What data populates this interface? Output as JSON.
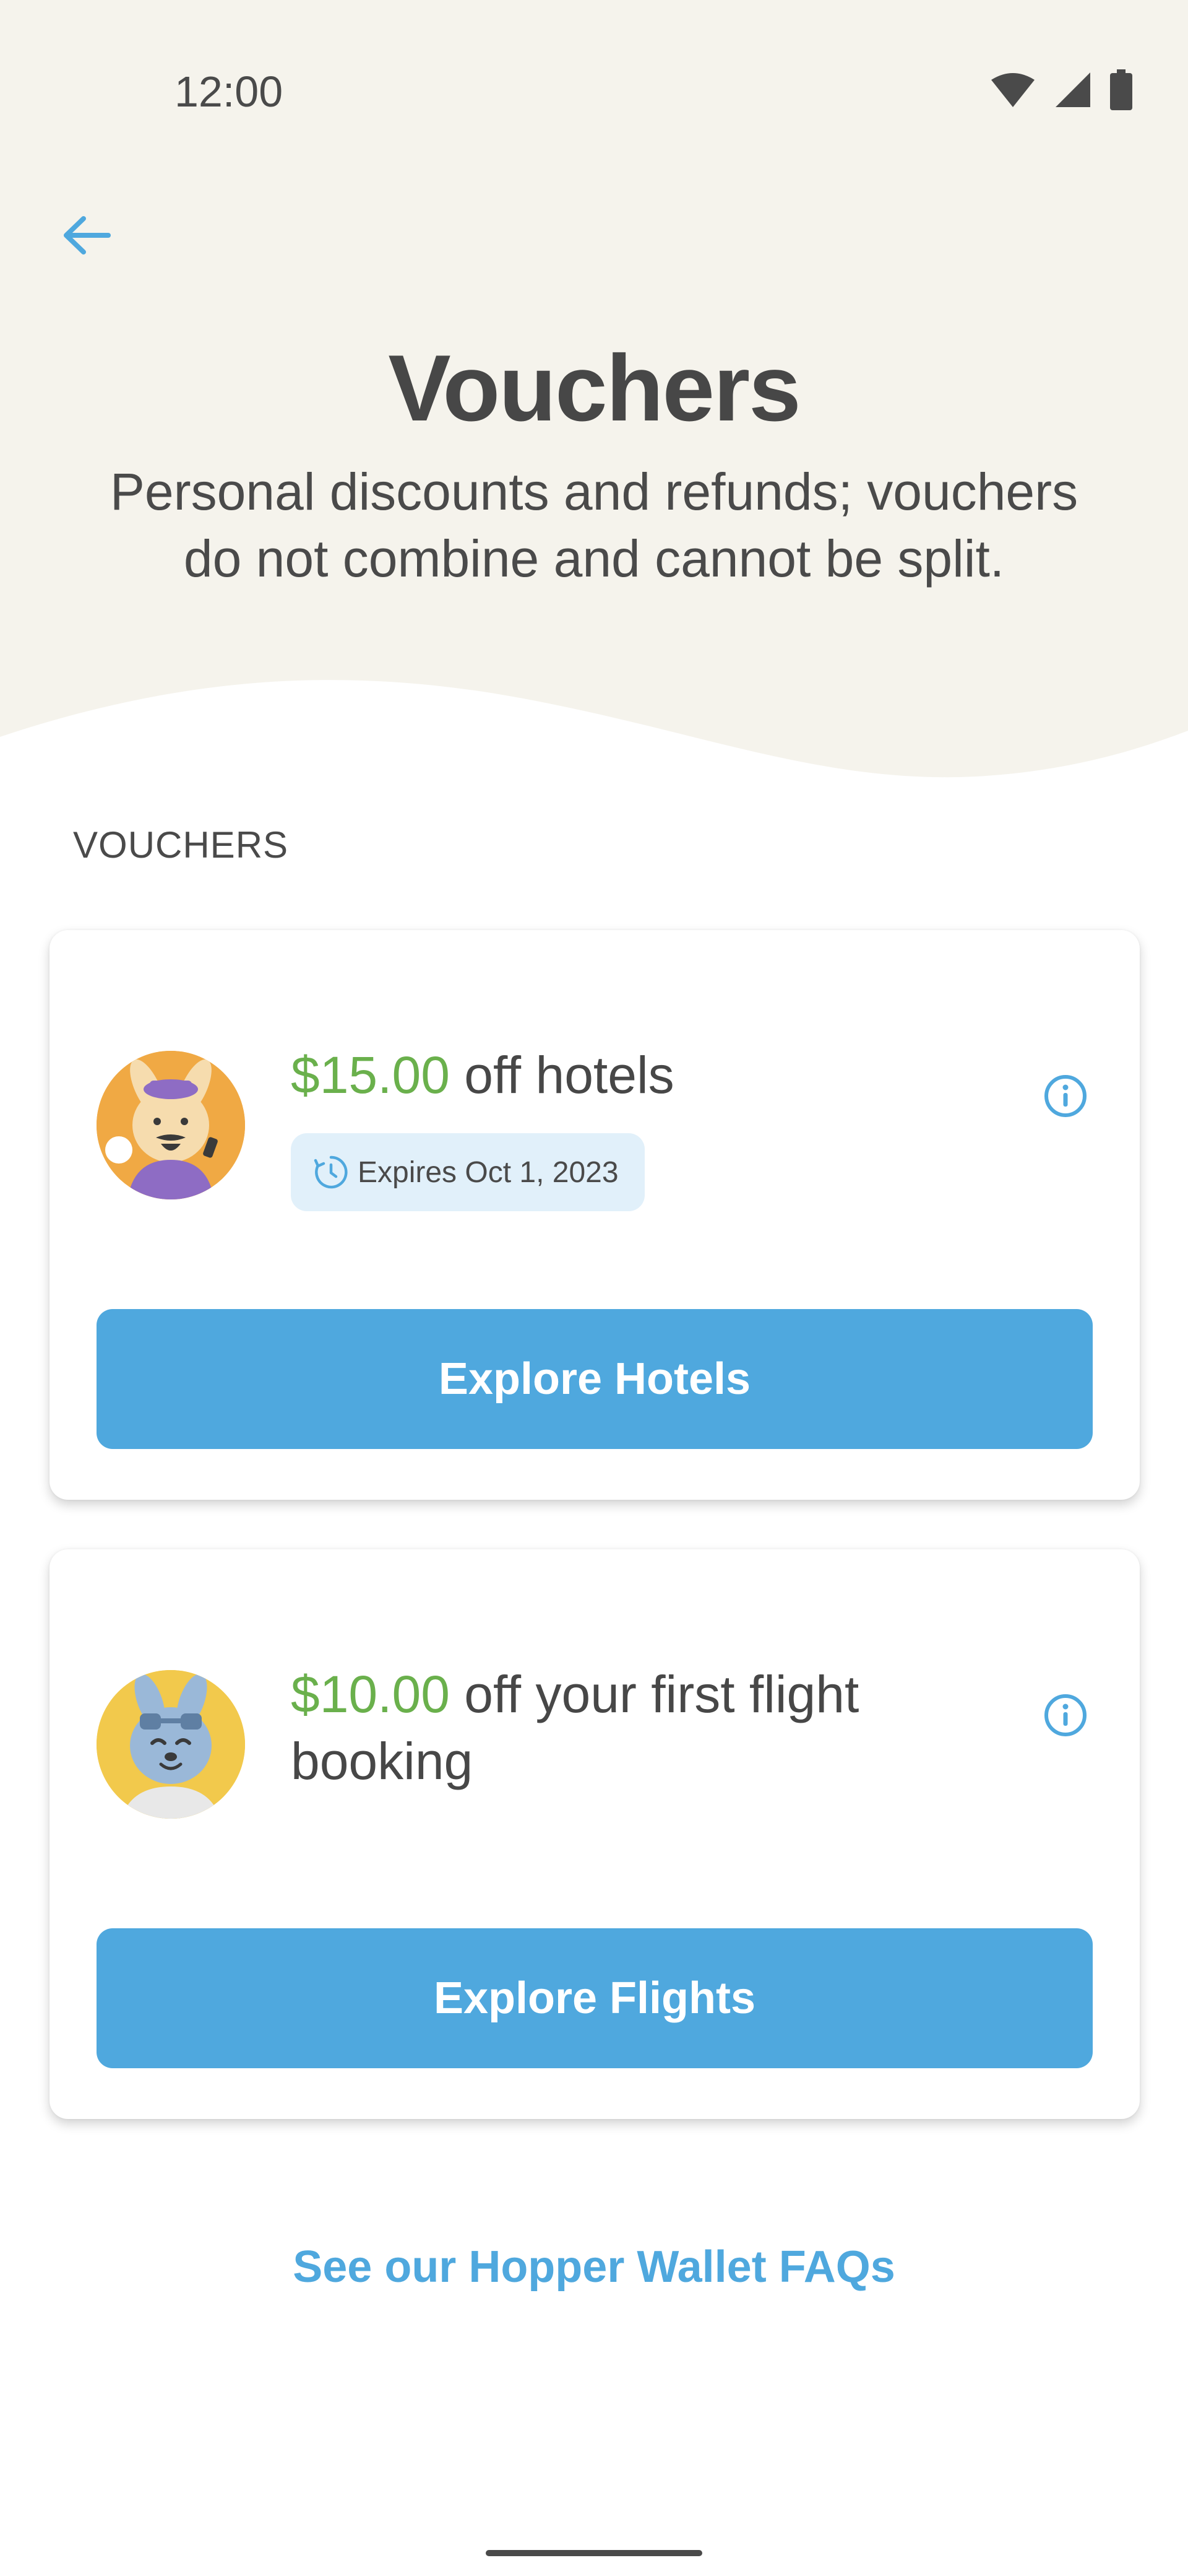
{
  "status_bar": {
    "time": "12:00",
    "icons": [
      "wifi-icon",
      "signal-icon",
      "battery-icon"
    ]
  },
  "header": {
    "back_icon": "arrow-left-icon",
    "title": "Vouchers",
    "subtitle": "Personal discounts and refunds; vouchers do not combine and cannot be split."
  },
  "section": {
    "label": "VOUCHERS"
  },
  "vouchers": [
    {
      "amount": "$15.00",
      "description": " off hotels",
      "expiry": "Expires Oct 1, 2023",
      "button_label": "Explore Hotels",
      "avatar": "bellhop-bunny-avatar",
      "info_icon": "info-icon"
    },
    {
      "amount": "$10.00",
      "description": " off your first flight booking",
      "button_label": "Explore Flights",
      "avatar": "pilot-bunny-avatar",
      "info_icon": "info-icon"
    }
  ],
  "footer": {
    "faq_link": "See our Hopper Wallet FAQs"
  },
  "colors": {
    "accent_blue": "#4fa8de",
    "amount_green": "#6ab04c",
    "hero_background": "#f5f3ec",
    "badge_background": "#e1f0fa"
  }
}
